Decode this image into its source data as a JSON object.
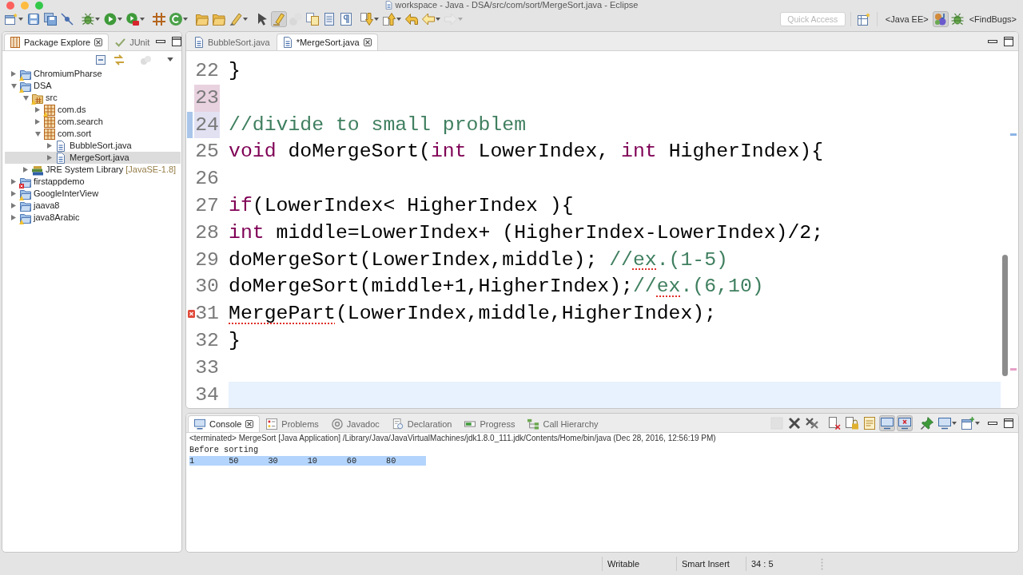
{
  "window": {
    "title": "workspace - Java - DSA/src/com/sort/MergeSort.java - Eclipse"
  },
  "toolbar": {
    "buttons": [
      {
        "dropdown": true,
        "pressed": false,
        "disabled": false
      },
      {
        "dropdown": false,
        "pressed": false,
        "disabled": false
      },
      {
        "dropdown": false,
        "pressed": false,
        "disabled": false
      },
      {
        "dropdown": false,
        "pressed": false,
        "disabled": false
      },
      {
        "dropdown": true,
        "pressed": false,
        "disabled": false
      },
      {
        "dropdown": true,
        "pressed": false,
        "disabled": false
      },
      {
        "dropdown": true,
        "pressed": false,
        "disabled": false
      },
      {
        "dropdown": false,
        "pressed": false,
        "disabled": false
      },
      {
        "dropdown": true,
        "pressed": false,
        "disabled": false
      },
      {
        "dropdown": false,
        "pressed": false,
        "disabled": false
      },
      {
        "dropdown": false,
        "pressed": false,
        "disabled": false
      },
      {
        "dropdown": true,
        "pressed": false,
        "disabled": false
      },
      {
        "dropdown": false,
        "pressed": false,
        "disabled": false
      },
      {
        "dropdown": false,
        "pressed": true,
        "disabled": false
      },
      {
        "dropdown": false,
        "pressed": false,
        "disabled": true
      },
      {
        "dropdown": false,
        "pressed": false,
        "disabled": false
      },
      {
        "dropdown": false,
        "pressed": false,
        "disabled": false
      },
      {
        "dropdown": false,
        "pressed": false,
        "disabled": false
      },
      {
        "dropdown": true,
        "pressed": false,
        "disabled": false
      },
      {
        "dropdown": true,
        "pressed": false,
        "disabled": false
      },
      {
        "dropdown": false,
        "pressed": false,
        "disabled": false
      },
      {
        "dropdown": true,
        "pressed": false,
        "disabled": false
      },
      {
        "dropdown": true,
        "pressed": false,
        "disabled": true
      }
    ],
    "quick_access": {
      "placeholder": "Quick Access"
    },
    "perspectives": [
      {
        "kind": "text",
        "label": "<Java EE>",
        "selected": false
      },
      {
        "kind": "icon",
        "selected": true
      },
      {
        "kind": "icon",
        "selected": false
      },
      {
        "kind": "text",
        "label": "<FindBugs>",
        "selected": false
      }
    ]
  },
  "package_explorer": {
    "tabs": [
      {
        "label": "Package Explore",
        "selected": true
      },
      {
        "label": "JUnit",
        "selected": false
      }
    ],
    "tree": [
      {
        "label": "ChromiumPharse",
        "kind": "project",
        "warning": true,
        "expanded": false,
        "selected": false
      },
      {
        "label": "DSA",
        "kind": "project",
        "warning": true,
        "expanded": true,
        "selected": false,
        "children": [
          {
            "label": "src",
            "kind": "source_folder",
            "warning": true,
            "expanded": true,
            "selected": false,
            "children": [
              {
                "label": "com.ds",
                "kind": "package",
                "warning": true,
                "expanded": false,
                "selected": false
              },
              {
                "label": "com.search",
                "kind": "package",
                "expanded": false,
                "selected": false
              },
              {
                "label": "com.sort",
                "kind": "package",
                "expanded": true,
                "selected": false,
                "children": [
                  {
                    "label": "BubbleSort.java",
                    "kind": "java_file",
                    "expanded": false,
                    "selected": false
                  },
                  {
                    "label": "MergeSort.java",
                    "kind": "java_file",
                    "expanded": false,
                    "selected": true
                  }
                ]
              }
            ]
          },
          {
            "label": "JRE System Library",
            "suffix": "[JavaSE-1.8]",
            "kind": "library",
            "expanded": false,
            "selected": false
          }
        ]
      },
      {
        "label": "firstappdemo",
        "kind": "project",
        "error": true,
        "expanded": false,
        "selected": false
      },
      {
        "label": "GoogleInterView",
        "kind": "project",
        "warning": true,
        "expanded": false,
        "selected": false
      },
      {
        "label": "jaava8",
        "kind": "project",
        "expanded": false,
        "selected": false
      },
      {
        "label": "java8Arabic",
        "kind": "project",
        "warning": true,
        "expanded": false,
        "selected": false
      }
    ]
  },
  "editor": {
    "tabs": [
      {
        "label": "BubbleSort.java",
        "selected": false
      },
      {
        "label": "*MergeSort.java",
        "selected": true
      }
    ],
    "lines": [
      {
        "number": "22",
        "tokens": [
          {
            "kind": "plain",
            "text": "    }"
          }
        ]
      },
      {
        "number": "23",
        "removed": true
      },
      {
        "number": "24",
        "added": true,
        "tokens": [
          {
            "kind": "comment",
            "text": "    //divide to small problem"
          }
        ]
      },
      {
        "number": "25",
        "tokens": [
          {
            "kind": "keyword",
            "text": "void"
          },
          {
            "kind": "plain",
            "text": " doMergeSort("
          },
          {
            "kind": "keyword",
            "text": "int"
          },
          {
            "kind": "plain",
            "text": " LowerIndex, "
          },
          {
            "kind": "keyword",
            "text": "int"
          },
          {
            "kind": "plain",
            "text": " HigherIndex){"
          }
        ]
      },
      {
        "number": "26"
      },
      {
        "number": "27",
        "tokens": [
          {
            "kind": "keyword",
            "text": "    if"
          },
          {
            "kind": "plain",
            "text": "(LowerIndex< HigherIndex ){"
          }
        ]
      },
      {
        "number": "28",
        "tokens": [
          {
            "kind": "keyword",
            "text": "    int"
          },
          {
            "kind": "plain",
            "text": " middle=LowerIndex+ (HigherIndex-LowerIndex)/2;"
          }
        ]
      },
      {
        "number": "29",
        "tokens": [
          {
            "kind": "plain",
            "text": "    doMergeSort(LowerIndex,middle); "
          },
          {
            "kind": "comment",
            "text": "//"
          },
          {
            "kind": "misspelled",
            "text": "ex"
          },
          {
            "kind": "comment",
            "text": ".(1-5)"
          }
        ]
      },
      {
        "number": "30",
        "tokens": [
          {
            "kind": "plain",
            "text": "    doMergeSort(middle+1,HigherIndex);"
          },
          {
            "kind": "comment",
            "text": "//"
          },
          {
            "kind": "misspelled",
            "text": "ex"
          },
          {
            "kind": "comment",
            "text": ".(6,10)"
          }
        ]
      },
      {
        "number": "31",
        "error_marker": true,
        "tokens": [
          {
            "kind": "error",
            "text": "    MergePart"
          },
          {
            "kind": "plain",
            "text": "(LowerIndex,middle,HigherIndex);"
          }
        ]
      },
      {
        "number": "32",
        "tokens": [
          {
            "kind": "plain",
            "text": "    }"
          }
        ]
      },
      {
        "number": "33"
      },
      {
        "number": "34",
        "current": true
      }
    ]
  },
  "console": {
    "tabs": [
      {
        "label": "Console",
        "selected": true
      },
      {
        "label": "Problems",
        "selected": false
      },
      {
        "label": "Javadoc",
        "selected": false
      },
      {
        "label": "Declaration",
        "selected": false
      },
      {
        "label": "Progress",
        "selected": false
      },
      {
        "label": "Call Hierarchy",
        "selected": false
      }
    ],
    "toolbar": [
      {
        "dropdown": false,
        "pressed": false,
        "disabled": true
      },
      {
        "dropdown": false,
        "pressed": false,
        "disabled": false
      },
      {
        "dropdown": false,
        "pressed": false,
        "disabled": false
      },
      {
        "dropdown": false,
        "pressed": false,
        "disabled": false
      },
      {
        "dropdown": false,
        "pressed": false,
        "disabled": false
      },
      {
        "dropdown": false,
        "pressed": false,
        "disabled": false
      },
      {
        "dropdown": false,
        "pressed": true,
        "disabled": false
      },
      {
        "dropdown": false,
        "pressed": true,
        "disabled": false
      },
      {
        "dropdown": false,
        "pressed": false,
        "disabled": false
      },
      {
        "dropdown": true,
        "pressed": false,
        "disabled": false
      },
      {
        "dropdown": true,
        "pressed": false,
        "disabled": false
      }
    ],
    "process": "<terminated> MergeSort [Java Application] /Library/Java/JavaVirtualMachines/jdk1.8.0_111.jdk/Contents/Home/bin/java (Dec 28, 2016, 12:56:19 PM)",
    "output": [
      {
        "text": "Before sorting",
        "selected": false
      },
      {
        "text": "1\t50\t30\t10\t60\t80",
        "selected": true
      }
    ]
  },
  "status_bar": {
    "fields": [
      "Writable",
      "Smart Insert",
      "34 : 5"
    ]
  }
}
